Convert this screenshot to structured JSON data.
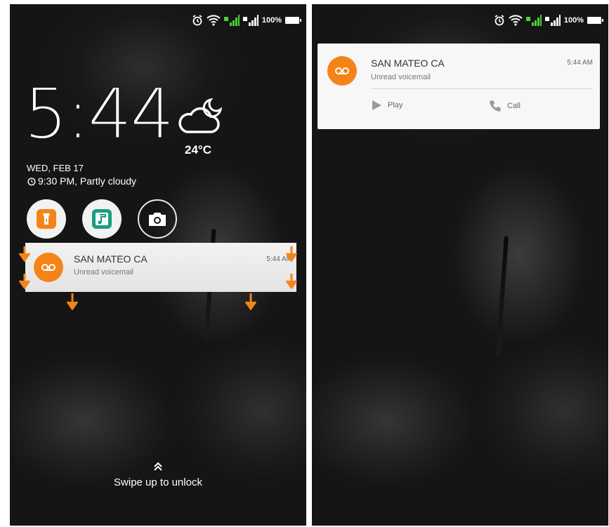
{
  "status_bar": {
    "battery": "100%"
  },
  "lockscreen": {
    "clock": "5:44",
    "temperature": "24°C",
    "date": "WED, FEB 17",
    "alarm_weather": "9:30 PM, Partly cloudy",
    "shortcuts": [
      "flashlight-icon",
      "music-icon",
      "camera-icon"
    ],
    "unlock_hint": "Swipe up to unlock"
  },
  "notification": {
    "title": "SAN MATEO   CA",
    "subtitle": "Unread voicemail",
    "time": "5:44 AM",
    "actions": {
      "play": "Play",
      "call": "Call"
    }
  },
  "colors": {
    "accent": "#f48418",
    "notification_bg": "#f7f7f7"
  }
}
